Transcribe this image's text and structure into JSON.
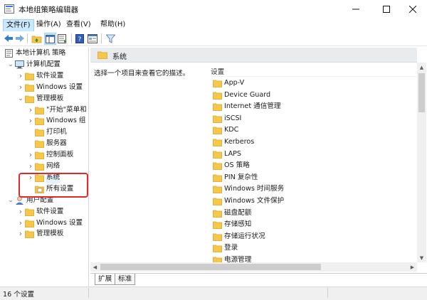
{
  "window": {
    "title": "本地组策略编辑器"
  },
  "menu": [
    "文件(F)",
    "操作(A)",
    "查看(V)",
    "帮助(H)"
  ],
  "tree": [
    {
      "label": "本地计算机 策略",
      "indent": 0,
      "icon": "policy-icon",
      "expander": ""
    },
    {
      "label": "计算机配置",
      "indent": 1,
      "icon": "computer-icon",
      "expander": "open"
    },
    {
      "label": "软件设置",
      "indent": 2,
      "icon": "folder-icon",
      "expander": "closed"
    },
    {
      "label": "Windows 设置",
      "indent": 2,
      "icon": "folder-icon",
      "expander": "closed"
    },
    {
      "label": "管理模板",
      "indent": 2,
      "icon": "folder-icon",
      "expander": "open"
    },
    {
      "label": "\"开始\"菜单和",
      "indent": 3,
      "icon": "folder-icon",
      "expander": "closed"
    },
    {
      "label": "Windows 组",
      "indent": 3,
      "icon": "folder-icon",
      "expander": "closed"
    },
    {
      "label": "打印机",
      "indent": 3,
      "icon": "folder-icon",
      "expander": ""
    },
    {
      "label": "服务器",
      "indent": 3,
      "icon": "folder-icon",
      "expander": ""
    },
    {
      "label": "控制面板",
      "indent": 3,
      "icon": "folder-icon",
      "expander": "closed"
    },
    {
      "label": "网络",
      "indent": 3,
      "icon": "folder-icon",
      "expander": "closed"
    },
    {
      "label": "系统",
      "indent": 3,
      "icon": "folder-icon",
      "expander": "closed",
      "selected": true
    },
    {
      "label": "所有设置",
      "indent": 3,
      "icon": "settings-folder-icon",
      "expander": ""
    },
    {
      "label": "用户配置",
      "indent": 1,
      "icon": "user-icon",
      "expander": "open"
    },
    {
      "label": "软件设置",
      "indent": 2,
      "icon": "folder-icon",
      "expander": "closed"
    },
    {
      "label": "Windows 设置",
      "indent": 2,
      "icon": "folder-icon",
      "expander": "closed"
    },
    {
      "label": "管理模板",
      "indent": 2,
      "icon": "folder-icon",
      "expander": "closed"
    }
  ],
  "content": {
    "header": "系统",
    "description": "选择一个项目来查看它的描述。",
    "column_header": "设置",
    "items": [
      "App-V",
      "Device Guard",
      "Internet 通信管理",
      "iSCSI",
      "KDC",
      "Kerberos",
      "LAPS",
      "OS 策略",
      "PIN 复杂性",
      "Windows 时间服务",
      "Windows 文件保护",
      "磁盘配额",
      "存储感知",
      "存储运行状况",
      "登录",
      "电源管理"
    ]
  },
  "tabs": [
    "扩展",
    "标准"
  ],
  "status": {
    "text": "16 个设置"
  },
  "colors": {
    "folder": "#f5c84c",
    "folder_dark": "#d9a520",
    "selection": "#e5f3ff",
    "highlight": "#e02a2a",
    "header_band": "#e8ecef"
  }
}
